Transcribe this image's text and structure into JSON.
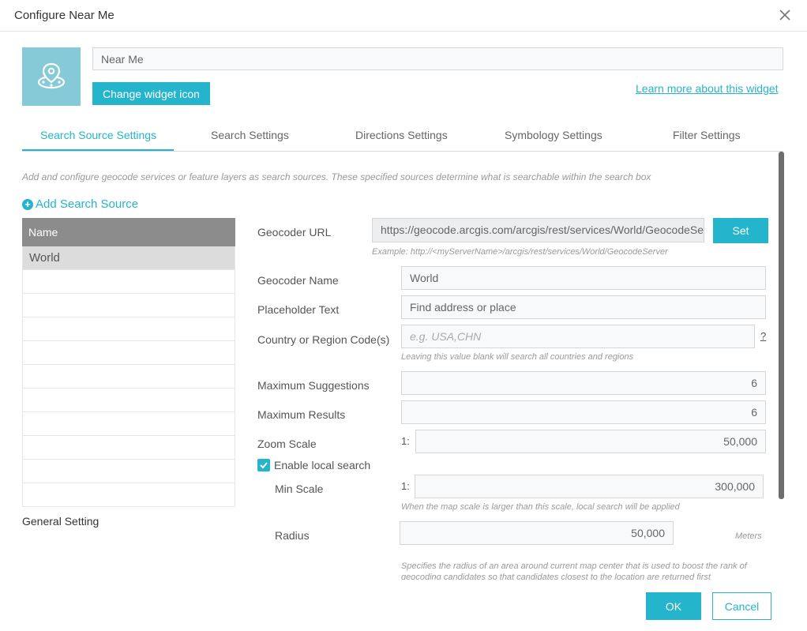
{
  "dialog": {
    "title": "Configure Near Me",
    "widget_name": "Near Me",
    "change_icon_label": "Change widget icon",
    "learn_more_label": "Learn more about this widget"
  },
  "tabs": [
    {
      "label": "Search Source Settings",
      "active": true
    },
    {
      "label": "Search Settings",
      "active": false
    },
    {
      "label": "Directions Settings",
      "active": false
    },
    {
      "label": "Symbology Settings",
      "active": false
    },
    {
      "label": "Filter Settings",
      "active": false
    }
  ],
  "description": "Add and configure geocode services or feature layers as search sources. These specified sources determine what is searchable within the search box",
  "add_source_label": "Add Search Source",
  "source_table": {
    "header": "Name",
    "rows": [
      "World"
    ]
  },
  "general_setting_label": "General Setting",
  "form": {
    "geocoder_url_label": "Geocoder URL",
    "geocoder_url_value": "https://geocode.arcgis.com/arcgis/rest/services/World/GeocodeServer",
    "set_label": "Set",
    "url_example": "Example: http://<myServerName>/arcgis/rest/services/World/GeocodeServer",
    "geocoder_name_label": "Geocoder Name",
    "geocoder_name_value": "World",
    "placeholder_text_label": "Placeholder Text",
    "placeholder_text_value": "Find address or place",
    "country_label": "Country or Region Code(s)",
    "country_placeholder": "e.g. USA,CHN",
    "country_help": "?",
    "country_hint": "Leaving this value blank will search all countries and regions",
    "max_suggestions_label": "Maximum Suggestions",
    "max_suggestions_value": "6",
    "max_results_label": "Maximum Results",
    "max_results_value": "6",
    "zoom_scale_label": "Zoom Scale",
    "scale_prefix": "1:",
    "zoom_scale_value": "50,000",
    "enable_local_search_label": "Enable local search",
    "enable_local_search_checked": true,
    "min_scale_label": "Min Scale",
    "min_scale_value": "300,000",
    "min_scale_hint": "When the map scale is larger than this scale, local search will be applied",
    "radius_label": "Radius",
    "radius_value": "50,000",
    "radius_unit": "Meters",
    "radius_hint": "Specifies the radius of an area around current map center that is used to boost the rank of geocoding candidates so that candidates closest to the location are returned first"
  },
  "buttons": {
    "ok": "OK",
    "cancel": "Cancel"
  },
  "colors": {
    "accent": "#24b5cc",
    "icon_tile": "#86cad7",
    "table_header": "#8c8c8c"
  }
}
